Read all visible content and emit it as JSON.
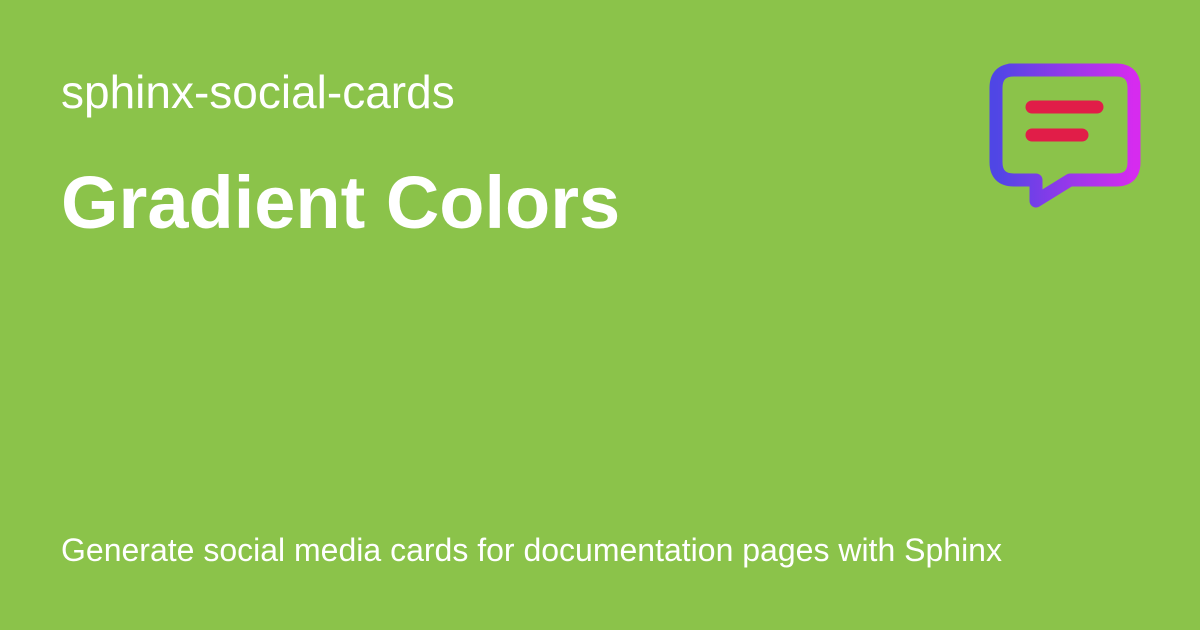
{
  "card": {
    "background_color": "#8bc34a",
    "text_color": "#ffffff",
    "site_name": "sphinx-social-cards",
    "page_title": "Gradient Colors",
    "description": "Generate social media cards for documentation pages with Sphinx"
  },
  "logo": {
    "icon": "chat-bubble-icon",
    "gradient_start": "#4f46e5",
    "gradient_end": "#d62bef",
    "line_color": "#e11d48"
  }
}
